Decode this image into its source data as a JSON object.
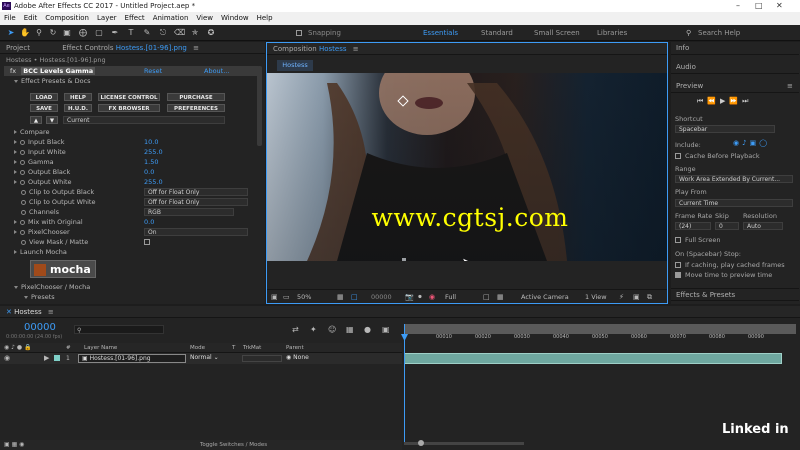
{
  "window": {
    "title": "Adobe After Effects CC 2017 - Untitled Project.aep *"
  },
  "menu": [
    "File",
    "Edit",
    "Composition",
    "Layer",
    "Effect",
    "Animation",
    "View",
    "Window",
    "Help"
  ],
  "toolbar": {
    "snapping": "Snapping",
    "workspaces": [
      "Essentials",
      "Standard",
      "Small Screen",
      "Libraries"
    ],
    "search_placeholder": "Search Help"
  },
  "project_panel": {
    "tab_project": "Project",
    "tab_effect_controls": "Effect Controls",
    "ec_layer": "Hostess.[01-96].png",
    "breadcrumb": "Hostess • Hostess.[01-96].png"
  },
  "effect": {
    "name": "BCC Levels Gamma",
    "reset": "Reset",
    "about": "About...",
    "presets_group": "Effect Presets & Docs",
    "buttons": [
      "LOAD",
      "HELP",
      "LICENSE CONTROL",
      "PURCHASE",
      "SAVE",
      "H.U.D.",
      "FX BROWSER",
      "PREFERENCES"
    ],
    "preset_current": "Current",
    "compare": "Compare",
    "params": [
      {
        "label": "Input Black",
        "value": "10.0"
      },
      {
        "label": "Input White",
        "value": "255.0"
      },
      {
        "label": "Gamma",
        "value": "1.50"
      },
      {
        "label": "Output Black",
        "value": "0.0"
      },
      {
        "label": "Output White",
        "value": "255.0"
      }
    ],
    "clip_black": {
      "label": "Clip to Output Black",
      "value": "Off for Float Only"
    },
    "clip_white": {
      "label": "Clip to Output White",
      "value": "Off for Float Only"
    },
    "channels": {
      "label": "Channels",
      "value": "RGB"
    },
    "mix": {
      "label": "Mix with Original",
      "value": "0.0"
    },
    "pixelchooser": {
      "label": "PixelChooser",
      "value": "On"
    },
    "view_mask": "View Mask / Matte",
    "launch_mocha": "Launch Mocha",
    "mocha_logo": "mocha",
    "pixelchooser_group": "PixelChooser / Mocha",
    "presets": "Presets"
  },
  "composition": {
    "tab_label": "Composition",
    "comp_name": "Hostess",
    "sub_tab": "Hostess",
    "watermark": "www.cgtsj.com",
    "footer": {
      "zoom": "50%",
      "timecode": "00000",
      "resolution": "Full",
      "camera": "Active Camera",
      "view": "1 View"
    }
  },
  "right_panel": {
    "info": "Info",
    "audio": "Audio",
    "preview": "Preview",
    "shortcut_label": "Shortcut",
    "shortcut_value": "Spacebar",
    "include": "Include:",
    "cache_before": "Cache Before Playback",
    "range_label": "Range",
    "range_value": "Work Area Extended By Current...",
    "play_from_label": "Play From",
    "play_from_value": "Current Time",
    "frame_rate_label": "Frame Rate",
    "skip_label": "Skip",
    "resolution_label": "Resolution",
    "frame_rate_value": "(24)",
    "skip_value": "0",
    "resolution_value": "Auto",
    "full_screen": "Full Screen",
    "on_stop": "On (Spacebar) Stop:",
    "if_caching": "If caching, play cached frames",
    "move_time": "Move time to preview time",
    "effects_presets": "Effects & Presets"
  },
  "timeline": {
    "tab": "Hostess",
    "timecode": "00000",
    "timecode_sub": "0:00:00:00 (24.00 fps)",
    "search_placeholder": "",
    "columns": {
      "layer_name": "Layer Name",
      "mode": "Mode",
      "t": "T",
      "trkmat": "TrkMat",
      "parent": "Parent"
    },
    "layer": {
      "index": "1",
      "name": "Hostess.[01-96].png",
      "mode": "Normal",
      "parent": "None"
    },
    "ruler": [
      "00010",
      "00020",
      "00030",
      "00040",
      "00050",
      "00060",
      "00070",
      "00080",
      "00090"
    ],
    "toggle": "Toggle Switches / Modes"
  },
  "brand": "Linked in"
}
